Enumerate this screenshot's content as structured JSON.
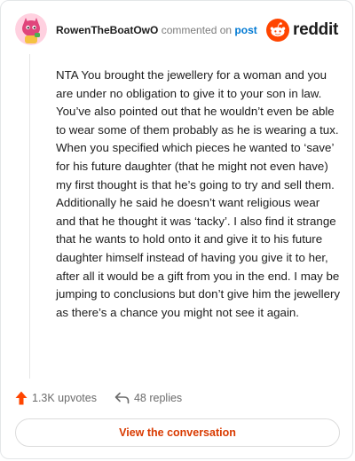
{
  "comment": {
    "username": "RowenTheBoatOwO",
    "action_text": "commented on",
    "post_link_text": "post",
    "body": "NTA You brought the jewellery for a woman and you are under no obligation to give it to your son in law. You’ve also pointed out that he wouldn’t even be able to wear some of them probably as he is wearing a tux. When you specified which pieces he wanted to ‘save’ for his future daughter (that he might not even have) my first thought is that he’s going to try and sell them. Additionally he said he doesn’t want religious wear and that he thought it was ‘tacky’. I also find it strange that he wants to hold onto it and give it to his future daughter himself instead of having you give it to her, after all it would be a gift from you in the end. I may be jumping to conclusions but don’t give him the jewellery as there’s a chance you might not see it again."
  },
  "brand": {
    "wordmark": "reddit",
    "icon": "reddit-snoo-icon",
    "color": "#ff4500"
  },
  "stats": {
    "upvotes": "1.3K upvotes",
    "upvote_icon": "upvote-arrow-icon",
    "upvote_color": "#ff4500",
    "replies": "48 replies",
    "reply_icon": "reply-arrow-icon"
  },
  "cta": {
    "label": "View the conversation",
    "color": "#d93a00"
  }
}
